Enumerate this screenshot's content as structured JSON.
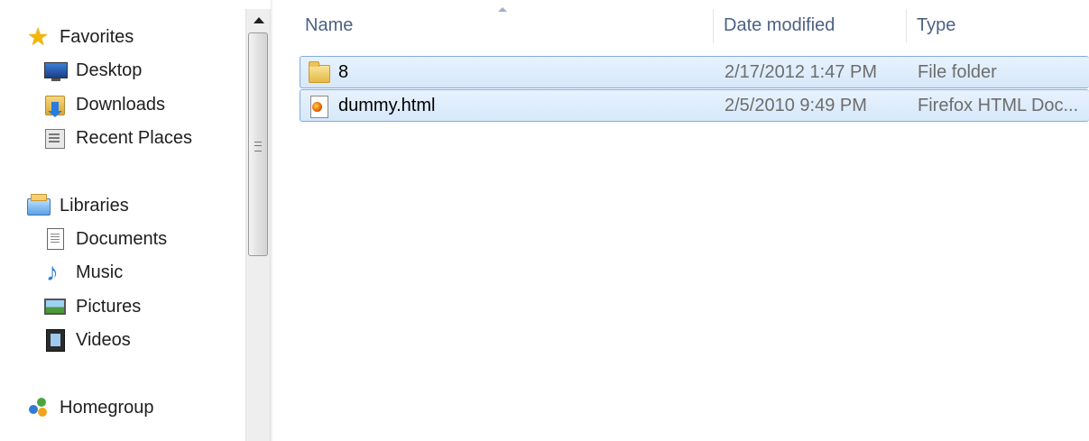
{
  "nav": {
    "favorites": {
      "label": "Favorites",
      "icon": "star-icon"
    },
    "favorites_items": [
      {
        "label": "Desktop",
        "icon": "desktop-icon"
      },
      {
        "label": "Downloads",
        "icon": "downloads-icon"
      },
      {
        "label": "Recent Places",
        "icon": "recent-places-icon"
      }
    ],
    "libraries": {
      "label": "Libraries",
      "icon": "libraries-icon"
    },
    "libraries_items": [
      {
        "label": "Documents",
        "icon": "documents-icon"
      },
      {
        "label": "Music",
        "icon": "music-icon"
      },
      {
        "label": "Pictures",
        "icon": "pictures-icon"
      },
      {
        "label": "Videos",
        "icon": "videos-icon"
      }
    ],
    "homegroup": {
      "label": "Homegroup",
      "icon": "homegroup-icon"
    }
  },
  "columns": {
    "name": "Name",
    "date_modified": "Date modified",
    "type": "Type"
  },
  "files": [
    {
      "name": "8",
      "date_modified": "2/17/2012 1:47 PM",
      "type": "File folder",
      "icon": "folder-icon"
    },
    {
      "name": "dummy.html",
      "date_modified": "2/5/2010 9:49 PM",
      "type": "Firefox HTML Doc...",
      "icon": "firefox-html-icon"
    }
  ],
  "colors": {
    "selection_bg": "#d6e8fb",
    "selection_border": "#84acdd",
    "header_text": "#4d6185",
    "detail_text": "#6d6d6d"
  }
}
